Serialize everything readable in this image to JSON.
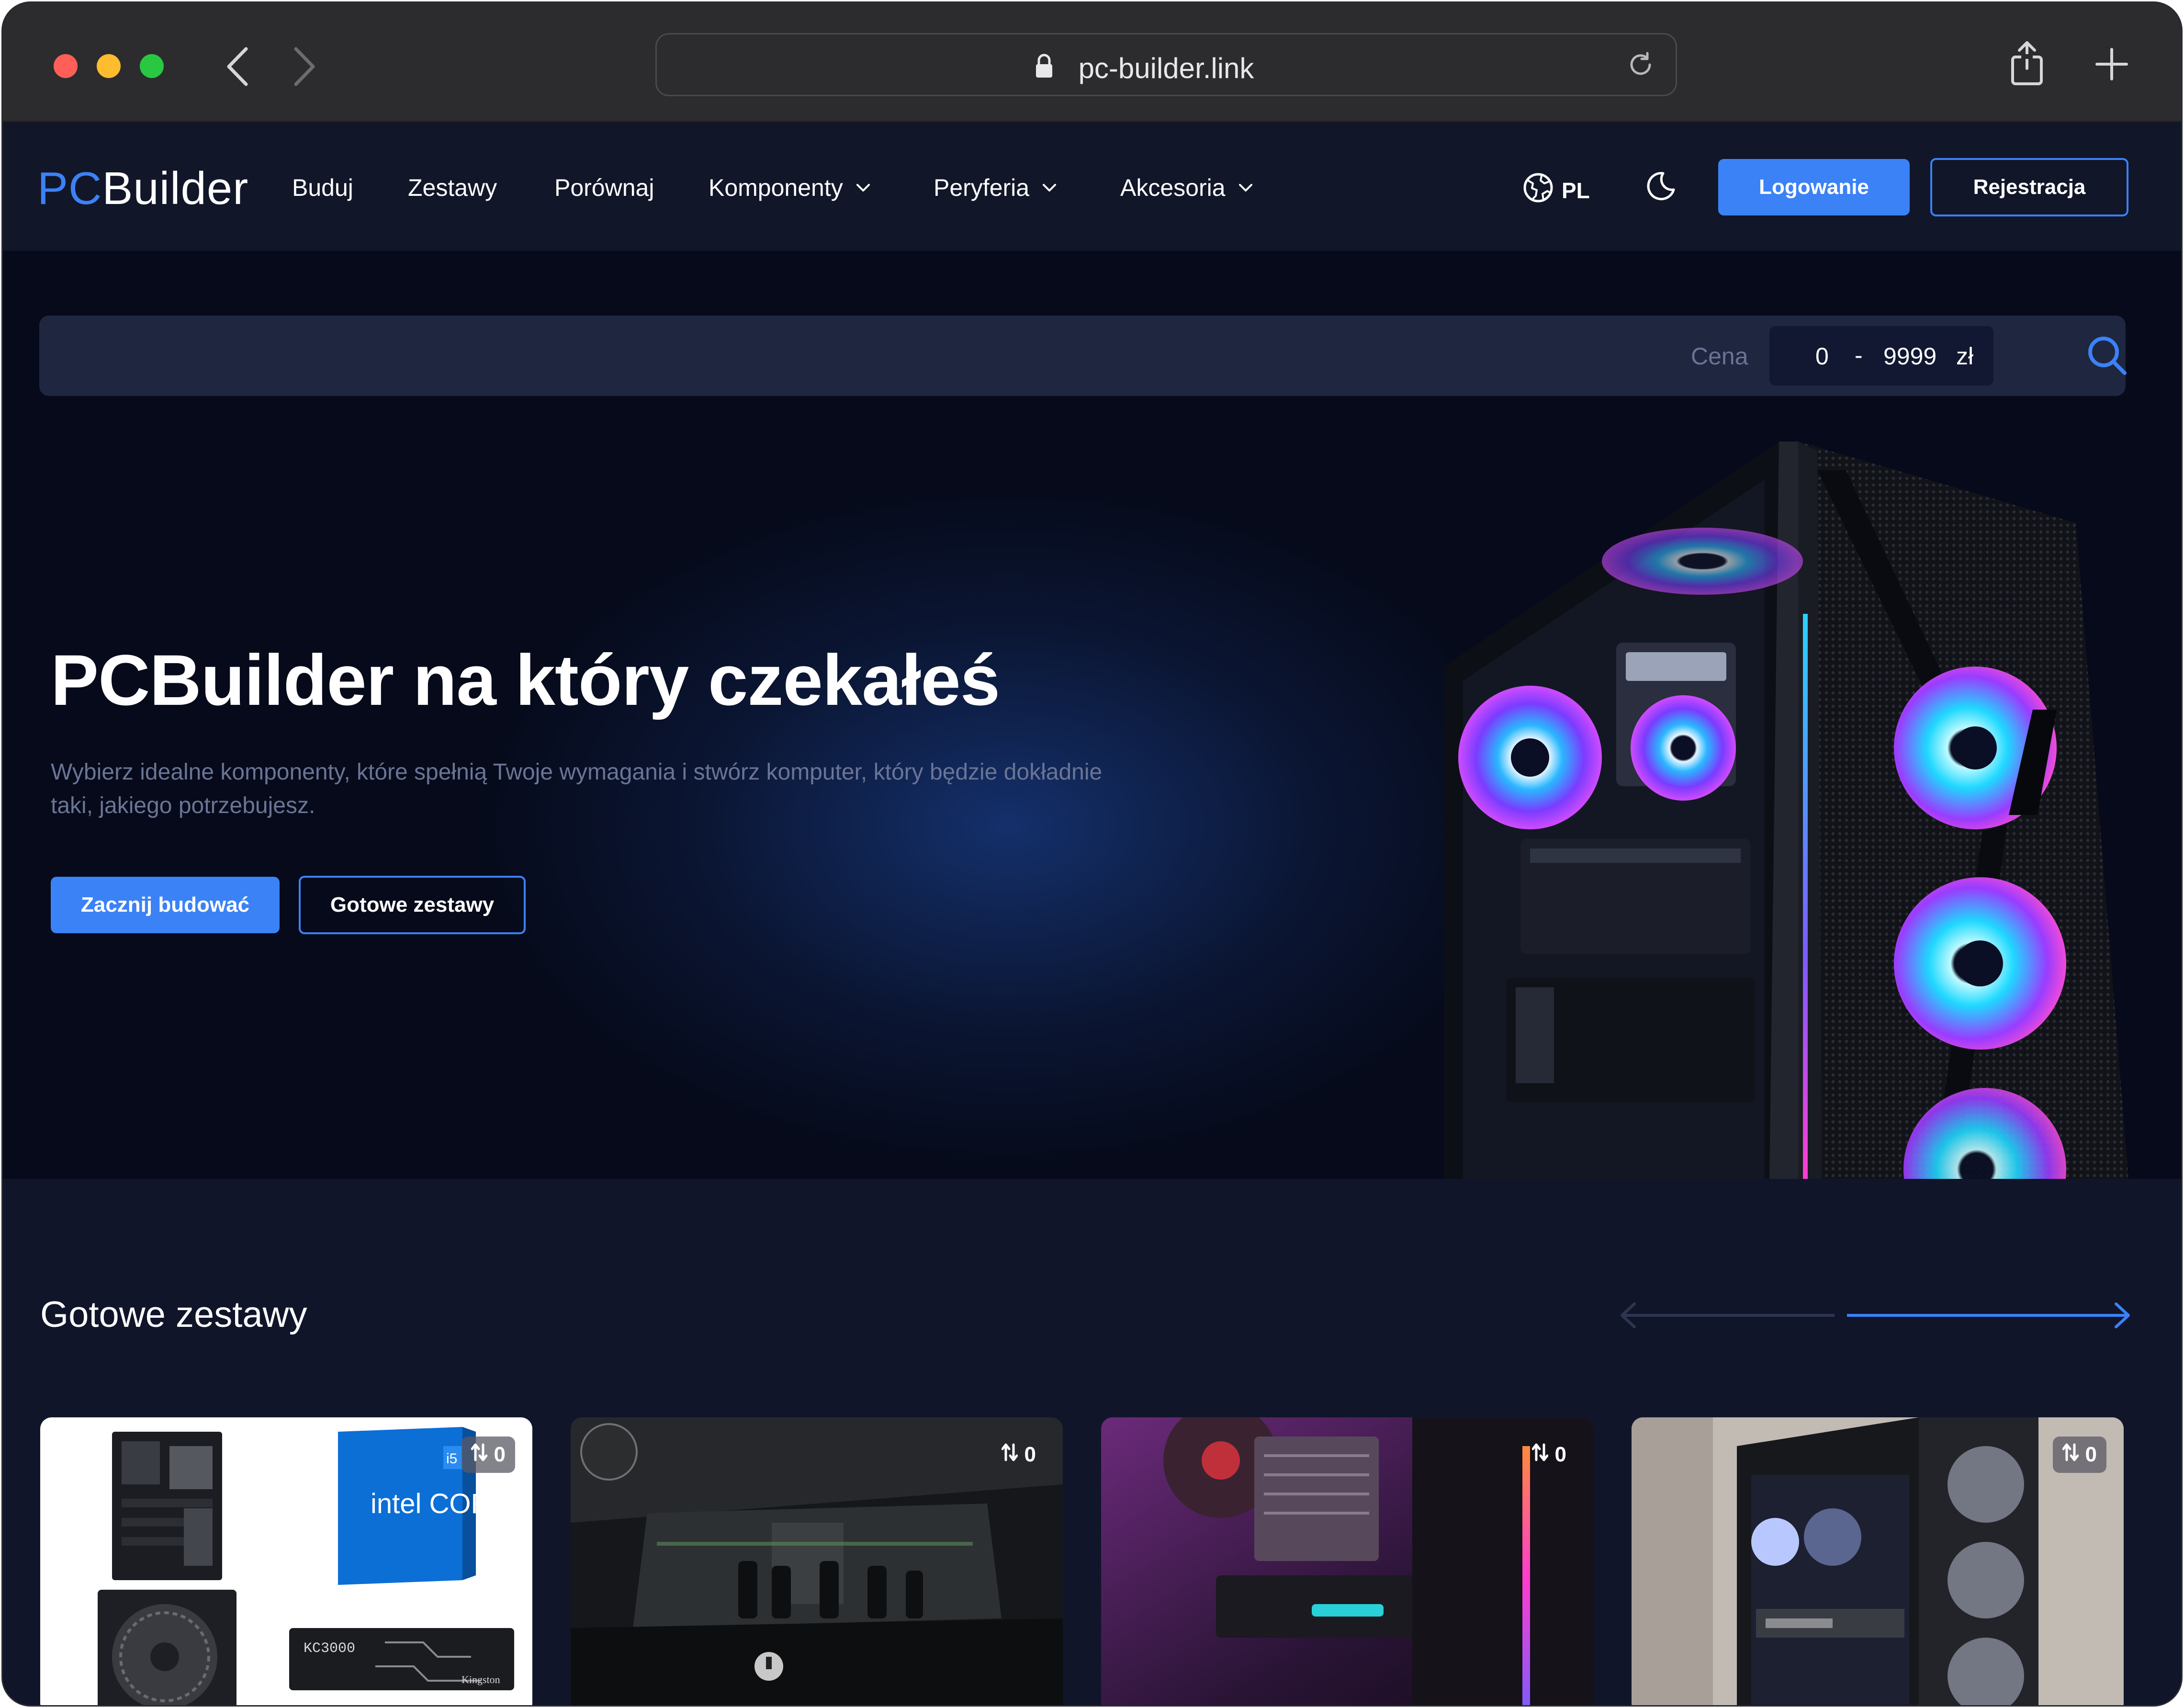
{
  "browser": {
    "url": "pc-builder.link",
    "icons": [
      "back-arrow-icon",
      "forward-arrow-icon",
      "lock-icon",
      "reload-icon",
      "share-icon",
      "new-tab-plus-icon"
    ]
  },
  "nav": {
    "logo_accent": "PC",
    "logo_main": "Builder",
    "items": [
      {
        "label": "Buduj",
        "dropdown": false
      },
      {
        "label": "Zestawy",
        "dropdown": false
      },
      {
        "label": "Porównaj",
        "dropdown": false
      },
      {
        "label": "Komponenty",
        "dropdown": true
      },
      {
        "label": "Peryferia",
        "dropdown": true
      },
      {
        "label": "Akcesoria",
        "dropdown": true
      }
    ],
    "language": "PL",
    "login_label": "Logowanie",
    "register_label": "Rejestracja"
  },
  "search": {
    "price_label": "Cena",
    "price_min": "0",
    "price_separator": "-",
    "price_max": "9999",
    "currency": "zł"
  },
  "hero": {
    "title": "PCBuilder na który czekałeś",
    "subtitle": "Wybierz idealne komponenty, które spełnią Twoje wymagania i stwórz komputer, który będzie dokładnie taki, jakiego potrzebujesz.",
    "primary_button": "Zacznij budować",
    "secondary_button": "Gotowe zestawy"
  },
  "sets": {
    "heading": "Gotowe zestawy",
    "cards": [
      {
        "badge": "0",
        "cpu_box_text": "intel CORE",
        "cpu_tier": "i5",
        "ssd_text": "KC3000",
        "ssd_brand": "Kingston"
      },
      {
        "badge": "0"
      },
      {
        "badge": "0"
      },
      {
        "badge": "0"
      }
    ]
  },
  "colors": {
    "accent": "#3b82f6",
    "nav_bg": "#121629",
    "hero_bg": "#060a1a",
    "section_bg": "#11152a"
  }
}
